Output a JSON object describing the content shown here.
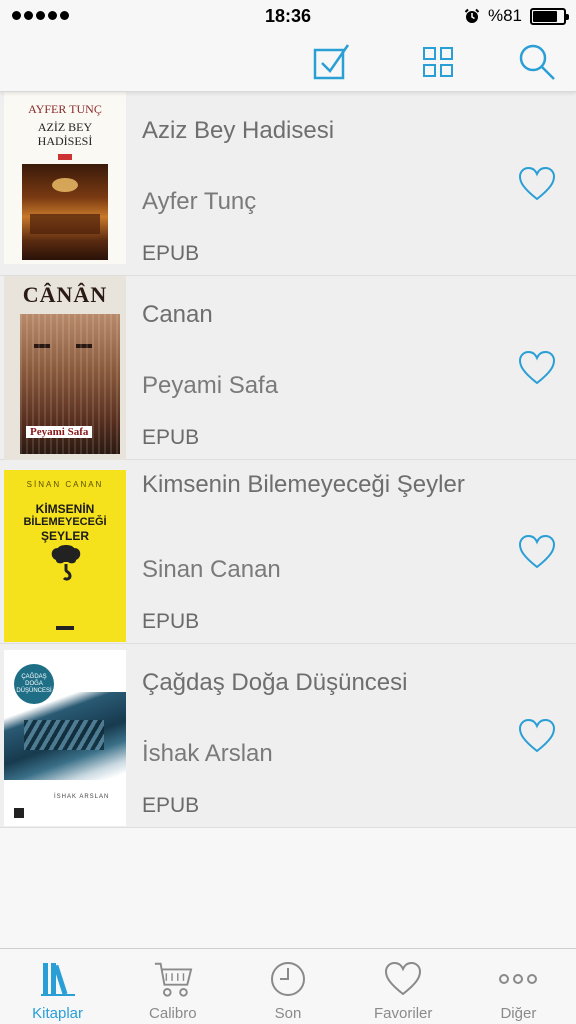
{
  "status_bar": {
    "time": "18:36",
    "battery_text": "%81",
    "battery_level": 0.81
  },
  "toolbar": {
    "icons": [
      "select-checkbox-icon",
      "grid-view-icon",
      "search-icon"
    ]
  },
  "accent_color": "#2a9fd6",
  "books": [
    {
      "title": "Aziz Bey Hadisesi",
      "author": "Ayfer Tunç",
      "format": "EPUB",
      "cover": {
        "author": "AYFER TUNÇ",
        "title_line1": "AZİZ BEY",
        "title_line2": "HADİSESİ"
      }
    },
    {
      "title": "Canan",
      "author": "Peyami Safa",
      "format": "EPUB",
      "cover": {
        "title": "CÂNÂN",
        "author": "Peyami Safa"
      }
    },
    {
      "title": "Kimsenin Bilemeyeceği Şeyler",
      "author": "Sinan Canan",
      "format": "EPUB",
      "cover": {
        "author": "SİNAN CANAN",
        "title_line1": "KİMSENİN",
        "title_line2": "BİLEMEYECEĞİ",
        "title_line3": "ŞEYLER"
      }
    },
    {
      "title": "Çağdaş Doğa Düşüncesi",
      "author": "İshak Arslan",
      "format": "EPUB",
      "cover": {
        "title_line1": "ÇAĞDAŞ",
        "title_line2": "DOĞA",
        "title_line3": "DÜŞÜNCESİ",
        "author": "İSHAK ARSLAN"
      }
    }
  ],
  "tabs": [
    {
      "label": "Kitaplar",
      "icon": "books-icon",
      "active": true
    },
    {
      "label": "Calibro",
      "icon": "cart-icon",
      "active": false
    },
    {
      "label": "Son",
      "icon": "clock-icon",
      "active": false
    },
    {
      "label": "Favoriler",
      "icon": "heart-icon",
      "active": false
    },
    {
      "label": "Diğer",
      "icon": "more-icon",
      "active": false
    }
  ]
}
